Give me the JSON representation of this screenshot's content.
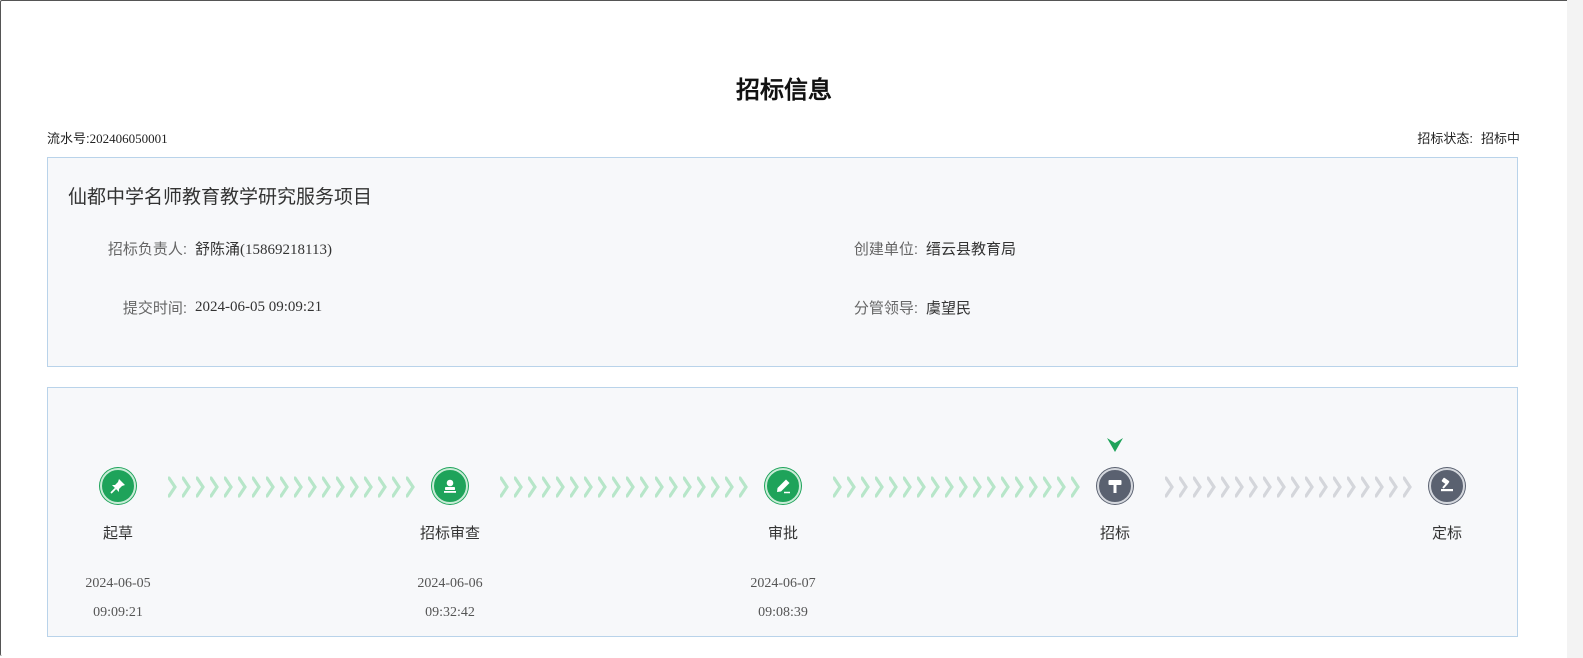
{
  "page": {
    "title": "招标信息",
    "serial_label": "流水号:",
    "serial_value": "202406050001",
    "status_label": "招标状态:",
    "status_value": "招标中"
  },
  "project": {
    "name": "仙都中学名师教育教学研究服务项目",
    "fields": [
      {
        "label": "招标负责人:",
        "value": "舒陈涌(15869218113)"
      },
      {
        "label": "创建单位:",
        "value": "缙云县教育局"
      },
      {
        "label": "提交时间:",
        "value": "2024-06-05 09:09:21"
      },
      {
        "label": "分管领导:",
        "value": "虞望民"
      }
    ]
  },
  "workflow": {
    "current_step_index": 3,
    "colors": {
      "done": "#1ea35a",
      "done_chevron": "#b7e6c9",
      "todo": "#5a6170",
      "todo_chevron": "#d4d6db"
    },
    "steps": [
      {
        "name": "起草",
        "icon": "pin-icon",
        "status": "done",
        "date": "2024-06-05",
        "time": "09:09:21"
      },
      {
        "name": "招标审查",
        "icon": "stamp-icon",
        "status": "done",
        "date": "2024-06-06",
        "time": "09:32:42"
      },
      {
        "name": "审批",
        "icon": "pen-icon",
        "status": "done",
        "date": "2024-06-07",
        "time": "09:08:39"
      },
      {
        "name": "招标",
        "icon": "hammer-icon",
        "status": "current",
        "date": "",
        "time": ""
      },
      {
        "name": "定标",
        "icon": "gavel-icon",
        "status": "todo",
        "date": "",
        "time": ""
      }
    ]
  }
}
